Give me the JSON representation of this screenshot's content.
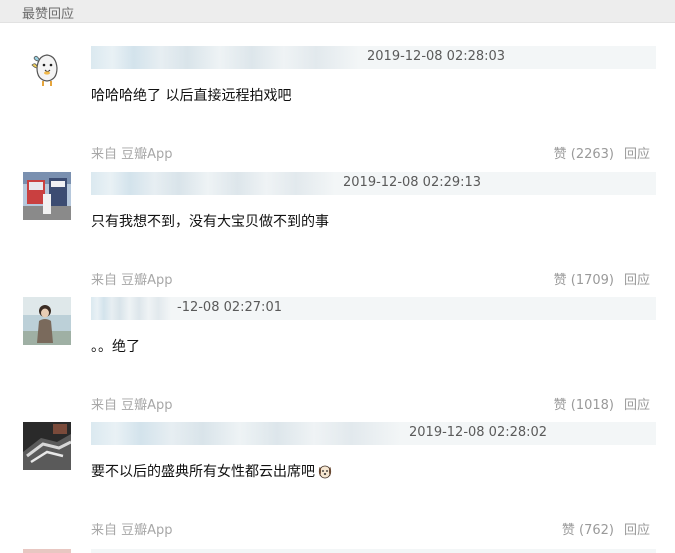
{
  "section": {
    "title": "最赞回应"
  },
  "comments": [
    {
      "timestamp": "2019-12-08 02:28:03",
      "text": "哈哈哈绝了 以后直接远程拍戏吧",
      "source": "来自 豆瓣App",
      "likes": "赞 (2263)",
      "reply": "回应"
    },
    {
      "timestamp": "2019-12-08 02:29:13",
      "text": "只有我想不到，没有大宝贝做不到的事",
      "source": "来自 豆瓣App",
      "likes": "赞 (1709)",
      "reply": "回应"
    },
    {
      "timestamp": "-12-08 02:27:01",
      "text": "。。绝了",
      "source": "来自 豆瓣App",
      "likes": "赞 (1018)",
      "reply": "回应"
    },
    {
      "timestamp": "2019-12-08 02:28:02",
      "text": "要不以后的盛典所有女性都云出席吧",
      "emoji": "dog-face-emoji",
      "source": "来自 豆瓣App",
      "likes": "赞 (762)",
      "reply": "回应"
    }
  ]
}
